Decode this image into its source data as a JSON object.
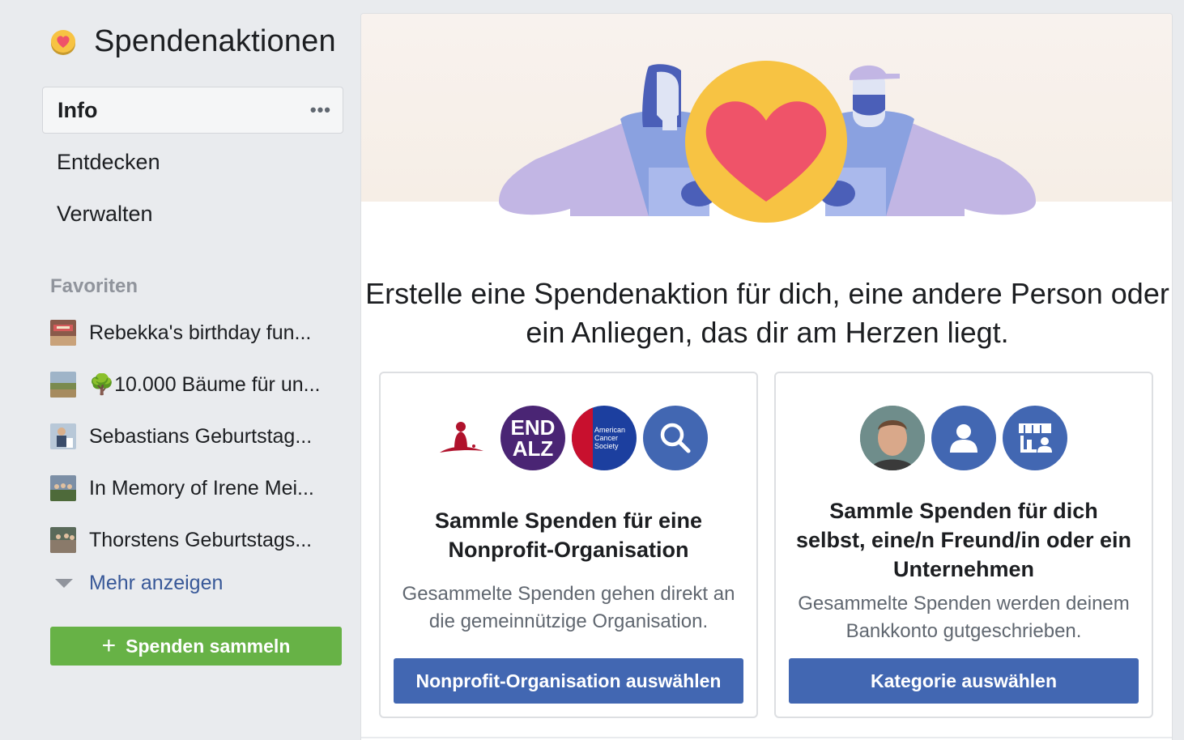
{
  "sidebar": {
    "title": "Spendenaktionen",
    "nav": [
      {
        "label": "Info"
      },
      {
        "label": "Entdecken"
      },
      {
        "label": "Verwalten"
      }
    ],
    "more_dots": "•••",
    "favorites_header": "Favoriten",
    "favorites": [
      {
        "label": "Rebekka's birthday fun..."
      },
      {
        "label": "🌳10.000 Bäume für un..."
      },
      {
        "label": "Sebastians Geburtstag..."
      },
      {
        "label": "In Memory of Irene Mei..."
      },
      {
        "label": "Thorstens Geburtstags..."
      }
    ],
    "show_more": "Mehr anzeigen",
    "create_button": "Spenden sammeln",
    "create_button_icon": "+"
  },
  "main": {
    "headline": "Erstelle eine Spendenaktion für dich, eine andere Person oder ein Anliegen, das dir am Herzen liegt.",
    "nonprofit_card": {
      "logos": [
        "St. Jude",
        "END ALZ",
        "American Cancer Society",
        "search-icon"
      ],
      "endalz_line1": "END",
      "endalz_line2": "ALZ",
      "acs_text": "American Cancer Society",
      "title": "Sammle Spenden für eine Nonprofit-Organisation",
      "description": "Gesammelte Spenden gehen direkt an die gemeinnützige Organisation.",
      "button": "Nonprofit-Organisation auswählen"
    },
    "personal_card": {
      "icons": [
        "profile-photo",
        "person-icon",
        "storefront-icon"
      ],
      "title": "Sammle Spenden für dich selbst, eine/n Freund/in oder ein Unternehmen",
      "description": "Gesammelte Spenden werden deinem Bankkonto gutgeschrieben.",
      "button": "Kategorie auswählen"
    }
  },
  "colors": {
    "accent_blue": "#4267b2",
    "link_blue": "#385898",
    "create_green": "#67b246",
    "heart_red": "#ef5369",
    "coin_yellow": "#f7c343"
  }
}
